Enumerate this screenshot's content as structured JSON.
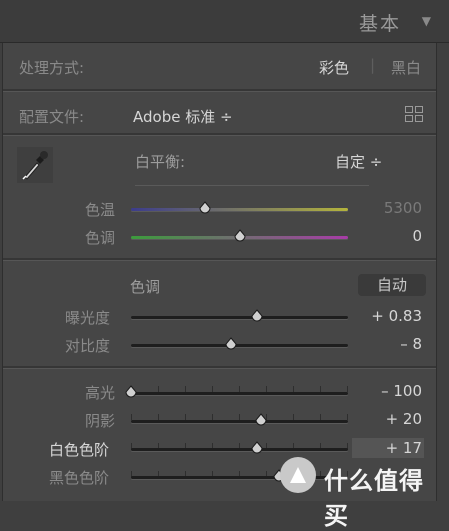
{
  "header": {
    "title": "基本"
  },
  "treatment": {
    "label": "处理方式:",
    "color": "彩色",
    "divider": "|",
    "bw": "黑白"
  },
  "profile": {
    "label": "配置文件:",
    "value": "Adobe 标准 ÷"
  },
  "white_balance": {
    "label": "白平衡:",
    "value": "自定 ÷"
  },
  "temp": {
    "label": "色温",
    "value": "5300",
    "position": 0.34
  },
  "tint": {
    "label": "色调",
    "value": "0",
    "position": 0.5
  },
  "tone": {
    "label": "色调",
    "auto": "自动"
  },
  "exposure": {
    "label": "曝光度",
    "value": "+ 0.83",
    "position": 0.58
  },
  "contrast": {
    "label": "对比度",
    "value": "– 8",
    "position": 0.46
  },
  "highlights": {
    "label": "高光",
    "value": "– 100",
    "position": 0.0
  },
  "shadows": {
    "label": "阴影",
    "value": "+ 20",
    "position": 0.6
  },
  "whites": {
    "label": "白色色阶",
    "value": "+ 17",
    "position": 0.58
  },
  "blacks": {
    "label": "黑色色阶",
    "value": "",
    "position": 0.68
  },
  "watermark": {
    "text": "什么值得买"
  },
  "colors": {
    "bg": "#464646",
    "temp_start": "#3c3c8c",
    "temp_end": "#b4b43c",
    "tint_start": "#3c9c3c",
    "tint_end": "#a83ca8"
  }
}
